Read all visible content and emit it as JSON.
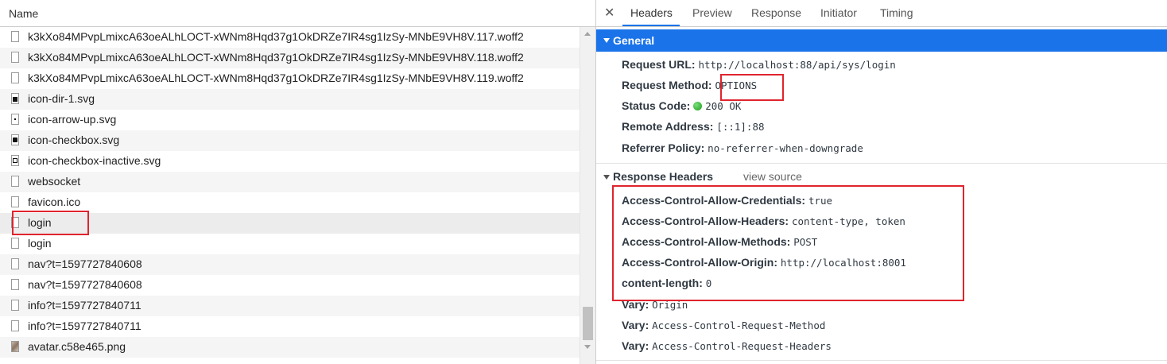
{
  "left_pane": {
    "header": "Name",
    "files": [
      {
        "name": "k3kXo84MPvpLmixcA63oeALhLOCT-xWNm8Hqd37g1OkDRZe7IR4sg1IzSy-MNbE9VH8V.117.woff2",
        "icon": "file-icon"
      },
      {
        "name": "k3kXo84MPvpLmixcA63oeALhLOCT-xWNm8Hqd37g1OkDRZe7IR4sg1IzSy-MNbE9VH8V.118.woff2",
        "icon": "file-icon"
      },
      {
        "name": "k3kXo84MPvpLmixcA63oeALhLOCT-xWNm8Hqd37g1OkDRZe7IR4sg1IzSy-MNbE9VH8V.119.woff2",
        "icon": "file-icon"
      },
      {
        "name": "icon-dir-1.svg",
        "icon": "svg-dir-icon"
      },
      {
        "name": "icon-arrow-up.svg",
        "icon": "svg-arrow-icon"
      },
      {
        "name": "icon-checkbox.svg",
        "icon": "svg-checkbox-icon"
      },
      {
        "name": "icon-checkbox-inactive.svg",
        "icon": "svg-checkbox-inactive-icon"
      },
      {
        "name": "websocket",
        "icon": "file-icon"
      },
      {
        "name": "favicon.ico",
        "icon": "file-icon"
      },
      {
        "name": "login",
        "icon": "file-icon"
      },
      {
        "name": "login",
        "icon": "file-icon"
      },
      {
        "name": "nav?t=1597727840608",
        "icon": "file-icon"
      },
      {
        "name": "nav?t=1597727840608",
        "icon": "file-icon"
      },
      {
        "name": "info?t=1597727840711",
        "icon": "file-icon"
      },
      {
        "name": "info?t=1597727840711",
        "icon": "file-icon"
      },
      {
        "name": "avatar.c58e465.png",
        "icon": "image-icon"
      }
    ]
  },
  "right_pane": {
    "close": "✕",
    "tabs": [
      "Headers",
      "Preview",
      "Response",
      "Initiator",
      "Timing"
    ],
    "active_tab": "Headers",
    "general": {
      "title": "General",
      "request_url_label": "Request URL:",
      "request_url": "http://localhost:88/api/sys/login",
      "request_method_label": "Request Method:",
      "request_method": "OPTIONS",
      "status_code_label": "Status Code:",
      "status_code": "200 OK",
      "remote_address_label": "Remote Address:",
      "remote_address": "[::1]:88",
      "referrer_policy_label": "Referrer Policy:",
      "referrer_policy": "no-referrer-when-downgrade"
    },
    "response_headers": {
      "title": "Response Headers",
      "view_source": "view source",
      "items": [
        {
          "key": "Access-Control-Allow-Credentials:",
          "value": "true"
        },
        {
          "key": "Access-Control-Allow-Headers:",
          "value": "content-type, token"
        },
        {
          "key": "Access-Control-Allow-Methods:",
          "value": "POST"
        },
        {
          "key": "Access-Control-Allow-Origin:",
          "value": "http://localhost:8001"
        },
        {
          "key": "content-length:",
          "value": "0"
        },
        {
          "key": "Vary:",
          "value": "Origin"
        },
        {
          "key": "Vary:",
          "value": "Access-Control-Request-Method"
        },
        {
          "key": "Vary:",
          "value": "Access-Control-Request-Headers"
        }
      ]
    }
  },
  "colors": {
    "accent": "#1a73e8",
    "highlight": "#e0242e",
    "status_ok": "#1b9b1b"
  }
}
